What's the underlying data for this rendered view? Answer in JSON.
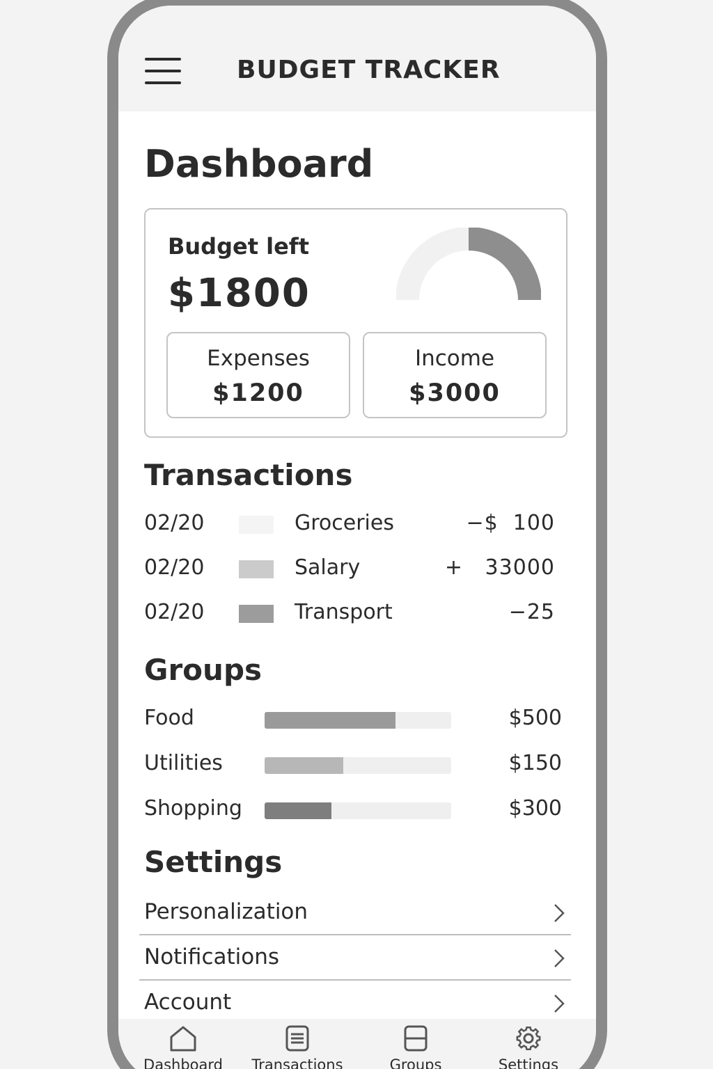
{
  "header": {
    "title": "BUDGET TRACKER",
    "menu_icon": "hamburger-icon"
  },
  "page_title": "Dashboard",
  "budget": {
    "label": "Budget left",
    "amount": "$1800",
    "gauge_fraction": 0.5,
    "expenses_label": "Expenses",
    "expenses_value": "$1200",
    "income_label": "Income",
    "income_value": "$3000"
  },
  "transactions": {
    "title": "Transactions",
    "rows": [
      {
        "date": "02/20",
        "category": "Groceries",
        "amount": "−$  100",
        "color": "#f4f4f4"
      },
      {
        "date": "02/20",
        "category": "Salary",
        "amount": "+   33000",
        "color": "#cbcbcb"
      },
      {
        "date": "02/20",
        "category": "Transport",
        "amount": "−25",
        "color": "#9c9c9c"
      }
    ]
  },
  "groups": {
    "title": "Groups",
    "rows": [
      {
        "name": "Food",
        "value": "$500",
        "fraction": 0.7,
        "color": "#9a9a9a"
      },
      {
        "name": "Utilities",
        "value": "$150",
        "fraction": 0.42,
        "color": "#b7b7b7"
      },
      {
        "name": "Shopping",
        "value": "$300",
        "fraction": 0.36,
        "color": "#7e7e7e"
      }
    ]
  },
  "settings": {
    "title": "Settings",
    "items": [
      "Personalization",
      "Notifications",
      "Account"
    ]
  },
  "nav": {
    "items": [
      {
        "label": "Dashboard",
        "icon": "home-icon"
      },
      {
        "label": "Transactions",
        "icon": "list-icon"
      },
      {
        "label": "Groups",
        "icon": "groups-icon"
      },
      {
        "label": "Settings",
        "icon": "gear-icon"
      }
    ]
  }
}
